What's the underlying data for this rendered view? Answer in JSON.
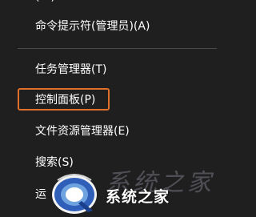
{
  "menu": {
    "items": [
      {
        "label": "命令提示符(管理员)(A)"
      },
      {
        "label": "任务管理器(T)"
      },
      {
        "label": "控制面板(P)"
      },
      {
        "label": "文件资源管理器(E)"
      },
      {
        "label": "搜索(S)"
      },
      {
        "label": "运"
      }
    ]
  },
  "watermark": {
    "text": "系统之家"
  },
  "colors": {
    "background": "#1f1f1f",
    "highlight_border": "#e0702a",
    "separator": "#4a4a4a"
  }
}
